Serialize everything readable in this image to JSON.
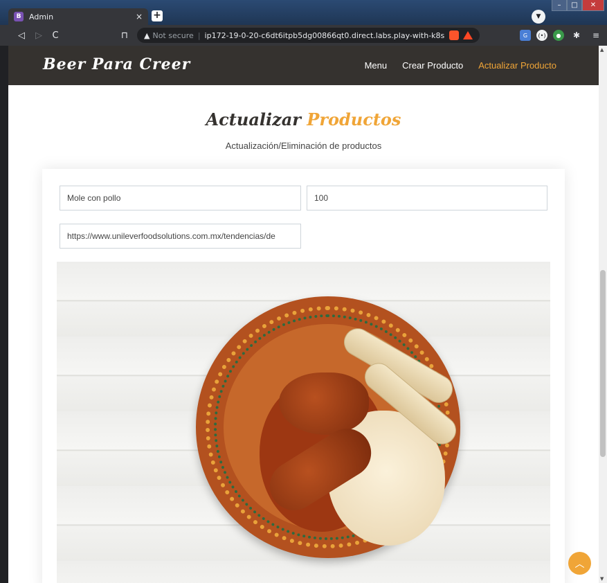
{
  "browser": {
    "tab": {
      "favicon": "B",
      "title": "Admin",
      "close": "×"
    },
    "new_tab": "+",
    "toolbar": {
      "back": "◁",
      "forward": "▷",
      "reload": "C",
      "bookmark": "⊓",
      "warning_icon": "▲",
      "not_secure": "Not secure",
      "separator": "|",
      "url": "ip172-19-0-20-c6dt6itpb5dg00866qt0.direct.labs.play-with-k8s.c...",
      "menu": "≡"
    }
  },
  "site": {
    "logo": "Beer Para Creer",
    "nav": [
      {
        "label": "Menu",
        "active": false
      },
      {
        "label": "Crear Producto",
        "active": false
      },
      {
        "label": "Actualizar Producto",
        "active": true
      }
    ]
  },
  "section": {
    "title_dark": "Actualizar",
    "title_accent": "Productos",
    "subtitle": "Actualización/Eliminación de productos"
  },
  "form": {
    "name_value": "Mole con pollo",
    "price_value": "100",
    "image_url_value": "https://www.unileverfoodsolutions.com.mx/tendencias/de"
  },
  "colors": {
    "accent": "#f0a537",
    "navbar": "#35322f"
  },
  "icons": {
    "back_to_top": "chevron-up-icon"
  }
}
